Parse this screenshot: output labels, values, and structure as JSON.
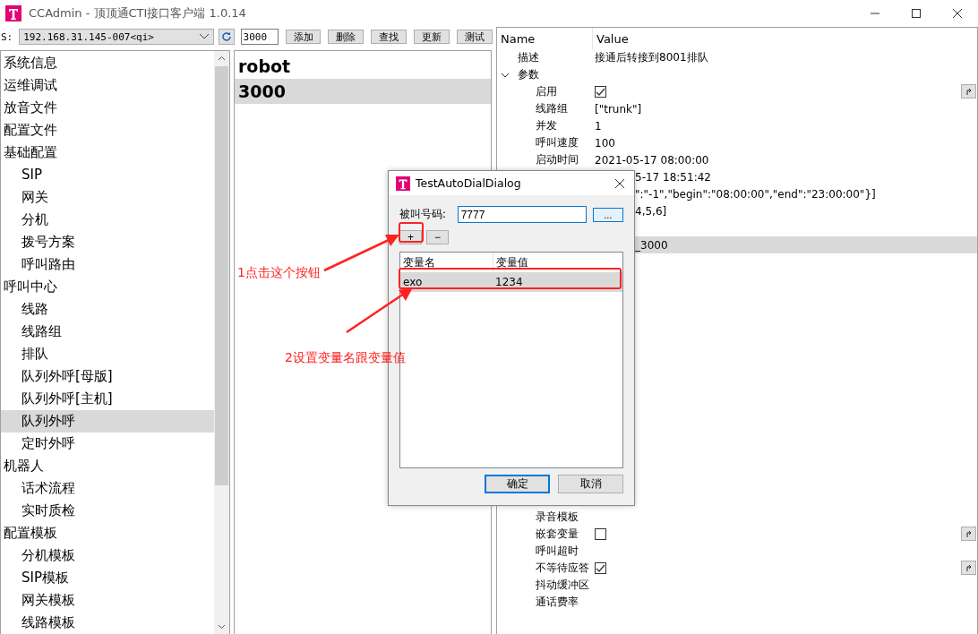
{
  "window": {
    "title": "CCAdmin - 顶顶通CTI接口客户端 1.0.14"
  },
  "toolbar": {
    "server_label": "S:",
    "server": "192.168.31.145-007<qi>",
    "search_value": "3000",
    "buttons": [
      "添加",
      "删除",
      "查找",
      "更新",
      "测试"
    ]
  },
  "tree": [
    {
      "label": "系统信息",
      "selected": false
    },
    {
      "label": "运维调试",
      "selected": false
    },
    {
      "label": "放音文件",
      "selected": false
    },
    {
      "label": "配置文件",
      "selected": false
    },
    {
      "label": "基础配置",
      "selected": false,
      "children": [
        {
          "label": "SIP",
          "selected": false
        },
        {
          "label": "网关",
          "selected": false
        },
        {
          "label": "分机",
          "selected": false
        },
        {
          "label": "拨号方案",
          "selected": false
        },
        {
          "label": "呼叫路由",
          "selected": false
        }
      ]
    },
    {
      "label": "呼叫中心",
      "selected": false,
      "children": [
        {
          "label": "线路",
          "selected": false
        },
        {
          "label": "线路组",
          "selected": false
        },
        {
          "label": "排队",
          "selected": false
        },
        {
          "label": "队列外呼[母版]",
          "selected": false
        },
        {
          "label": "队列外呼[主机]",
          "selected": false
        },
        {
          "label": "队列外呼",
          "selected": true
        },
        {
          "label": "定时外呼",
          "selected": false
        }
      ]
    },
    {
      "label": "机器人",
      "selected": false,
      "children": [
        {
          "label": "话术流程",
          "selected": false
        },
        {
          "label": "实时质检",
          "selected": false
        }
      ]
    },
    {
      "label": "配置模板",
      "selected": false,
      "children": [
        {
          "label": "分机模板",
          "selected": false
        },
        {
          "label": "SIP模板",
          "selected": false
        },
        {
          "label": "网关模板",
          "selected": false
        },
        {
          "label": "线路模板",
          "selected": false
        }
      ]
    }
  ],
  "items": [
    {
      "label": "robot",
      "selected": false
    },
    {
      "label": "3000",
      "selected": true
    }
  ],
  "properties": {
    "columns": [
      "Name",
      "Value"
    ],
    "top_rows": [
      {
        "kind": "text",
        "name": "描述",
        "value": "接通后转接到8001排队",
        "selected": false
      },
      {
        "kind": "group",
        "name": "参数",
        "expanded": true,
        "selected": false
      },
      {
        "kind": "check",
        "name": "启用",
        "checked": true,
        "selected": false
      },
      {
        "kind": "text",
        "name": "线路组",
        "value": "[\"trunk\"]",
        "selected": false
      },
      {
        "kind": "text",
        "name": "并发",
        "value": "1",
        "selected": false
      },
      {
        "kind": "text",
        "name": "呼叫速度",
        "value": "100",
        "selected": false
      },
      {
        "kind": "text",
        "name": "启动时间",
        "value": "2021-05-17 08:00:00",
        "selected": false
      },
      {
        "kind": "partial",
        "value": "5-17 18:51:42",
        "selected": false
      },
      {
        "kind": "partial",
        "value": "\":\"-1\",\"begin\":\"08:00:00\",\"end\":\"23:00:00\"}]",
        "selected": false
      },
      {
        "kind": "partial",
        "value": "4,5,6]",
        "selected": false
      },
      {
        "kind": "partial",
        "selected": false
      },
      {
        "kind": "partial",
        "value": "_3000",
        "selected": true
      }
    ],
    "bottom_rows": [
      {
        "kind": "text",
        "name": "录音模板",
        "selected": false
      },
      {
        "kind": "check",
        "name": "嵌套变量",
        "checked": false,
        "selected": false
      },
      {
        "kind": "text",
        "name": "呼叫超时",
        "selected": false
      },
      {
        "kind": "check",
        "name": "不等待应答",
        "checked": true,
        "selected": false
      },
      {
        "kind": "text",
        "name": "抖动缓冲区",
        "selected": false
      },
      {
        "kind": "text",
        "name": "通话费率",
        "selected": false
      }
    ]
  },
  "dialog": {
    "title": "TestAutoDialDialog",
    "number_label": "被叫号码:",
    "number": "7777",
    "browse": "...",
    "add": "+",
    "remove": "−",
    "columns": [
      "变量名",
      "变量值"
    ],
    "rows": [
      {
        "name": "exo",
        "value": "1234",
        "selected": true
      }
    ],
    "ok": "确定",
    "cancel": "取消"
  },
  "annotations": [
    "1点击这个按钮",
    "2设置变量名跟变量值"
  ]
}
